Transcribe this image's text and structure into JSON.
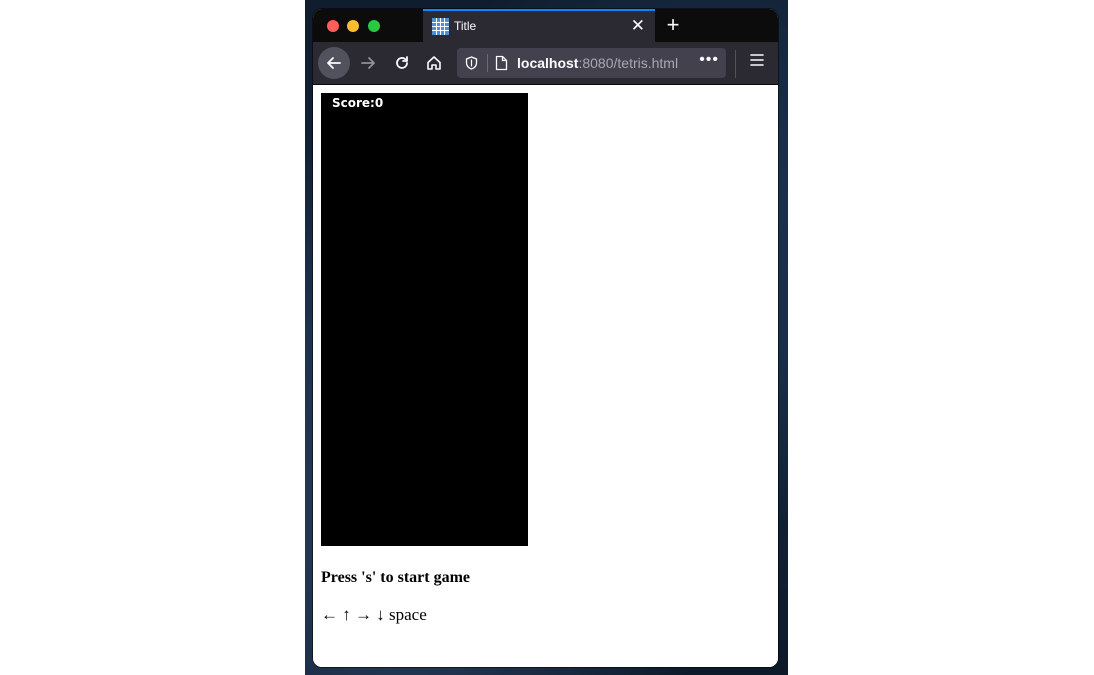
{
  "browser": {
    "tab_title": "Title",
    "tab_close": "✕",
    "new_tab": "+",
    "url_host": "localhost",
    "url_rest": ":8080/tetris.html",
    "url_more": "•••",
    "accent_color": "#0a84ff",
    "icons": [
      "back-arrow-icon",
      "forward-arrow-icon",
      "reload-icon",
      "home-icon",
      "shield-icon",
      "page-icon",
      "menu-icon",
      "grid-favicon-icon"
    ]
  },
  "game": {
    "score_label": "Score:0",
    "start_text": "Press 's' to start game",
    "controls_text": "← ↑ → ↓ space"
  }
}
